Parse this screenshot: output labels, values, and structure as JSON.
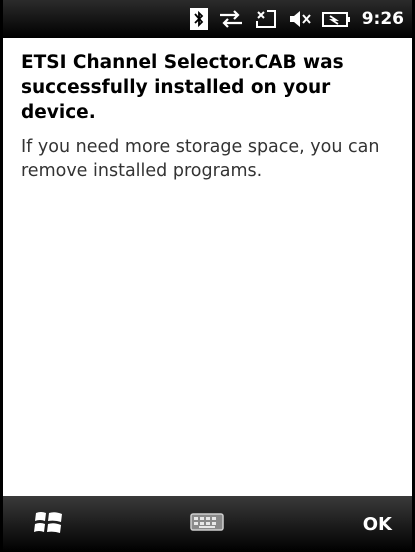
{
  "status_bar": {
    "time": "9:26",
    "icons": [
      "bluetooth-icon",
      "connectivity-icon",
      "message-icon",
      "speaker-icon",
      "battery-icon"
    ]
  },
  "dialog": {
    "title": "ETSI Channel Selector.CAB was successfully installed on your device.",
    "message": "If you need more storage space, you can remove installed programs."
  },
  "softkeys": {
    "left_icon": "windows-start-icon",
    "center_icon": "keyboard-icon",
    "right_label": "OK"
  },
  "colors": {
    "bar_background": "#000000",
    "bar_text": "#ffffff",
    "content_background": "#ffffff"
  }
}
